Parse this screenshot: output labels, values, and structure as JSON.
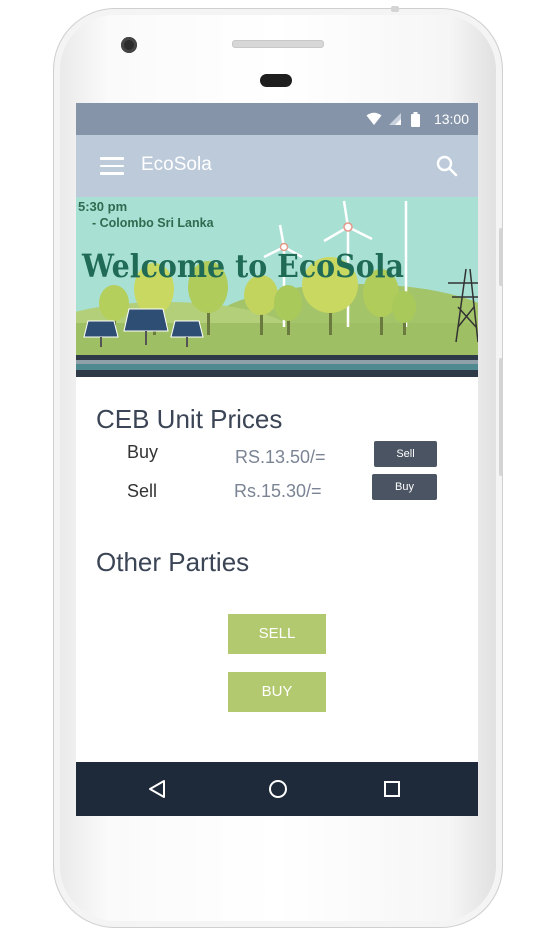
{
  "status_bar": {
    "time": "13:00"
  },
  "app_bar": {
    "title": "EcoSola"
  },
  "banner": {
    "time_text": "5:30 pm",
    "location_text": "- Colombo Sri Lanka",
    "welcome_text": "Welcome to EcoSola"
  },
  "ceb": {
    "heading": "CEB Unit Prices",
    "rows": [
      {
        "label": "Buy",
        "price": "RS.13.50/=",
        "button": "Sell"
      },
      {
        "label": "Sell",
        "price": "Rs.15.30/=",
        "button": "Buy"
      }
    ]
  },
  "other": {
    "heading": "Other Parties",
    "sell_button": "SELL",
    "buy_button": "BUY"
  },
  "colors": {
    "status_bar": "#8694a9",
    "app_bar": "#bccada",
    "accent_green": "#b3c96f",
    "dark_button": "#4a5462",
    "nav_bar": "#1e2a3a"
  }
}
